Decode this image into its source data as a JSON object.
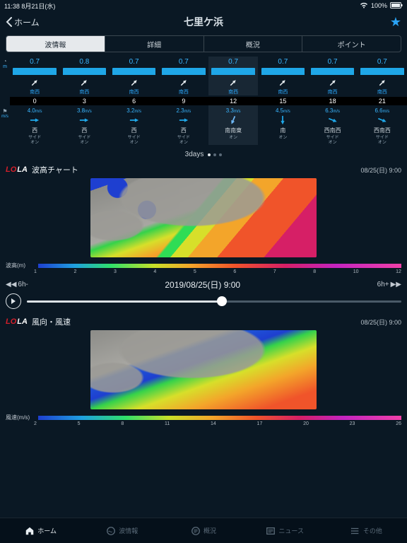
{
  "status": {
    "time": "11:38",
    "date": "8月21日(水)",
    "wifi": "wifi-icon",
    "battery": "100%"
  },
  "nav": {
    "back_label": "ホーム",
    "title": "七里ケ浜"
  },
  "tabs": [
    "波情報",
    "詳細",
    "概況",
    "ポイント"
  ],
  "forecast": {
    "hours": [
      "0",
      "3",
      "6",
      "9",
      "12",
      "15",
      "18",
      "21"
    ],
    "wave_height": [
      "0.7",
      "0.8",
      "0.7",
      "0.7",
      "0.7",
      "0.7",
      "0.7",
      "0.7"
    ],
    "wave_dir_label": [
      "南西",
      "南西",
      "南西",
      "南西",
      "南西",
      "南西",
      "南西",
      "南西"
    ],
    "wind_speed": [
      "4.0",
      "3.8",
      "3.2",
      "2.3",
      "3.3",
      "4.5",
      "6.3",
      "6.6"
    ],
    "wind_unit": "m/s",
    "wind_dir_label": [
      "西",
      "西",
      "西",
      "西",
      "南南東",
      "南",
      "西南西",
      "西南西"
    ],
    "side_label": [
      "サイド\nオン",
      "サイド\nオン",
      "サイド\nオン",
      "サイド\nオン",
      "オン",
      "オン",
      "サイド\nオン",
      "サイド\nオン"
    ],
    "highlight_index": 4,
    "pagination_label": "3days"
  },
  "chart1": {
    "title": "波高チャート",
    "timestamp": "08/25(日) 9:00",
    "scale_label": "波高(m)",
    "ticks": [
      "1",
      "2",
      "3",
      "4",
      "5",
      "6",
      "7",
      "8",
      "10",
      "12"
    ]
  },
  "scrubber": {
    "left": "6h-",
    "right": "6h+",
    "center": "2019/08/25(日) 9:00"
  },
  "chart2": {
    "title": "風向・風速",
    "timestamp": "08/25(日) 9:00",
    "scale_label": "風速(m/s)",
    "ticks": [
      "2",
      "5",
      "8",
      "11",
      "14",
      "17",
      "20",
      "23",
      "26"
    ]
  },
  "bottom_tabs": [
    "ホーム",
    "波情報",
    "概況",
    "ニュース",
    "その他"
  ],
  "chart_data": [
    {
      "type": "table",
      "title": "Hourly wave & wind forecast",
      "categories": [
        "0",
        "3",
        "6",
        "9",
        "12",
        "15",
        "18",
        "21"
      ],
      "series": [
        {
          "name": "wave_height_m",
          "values": [
            0.7,
            0.8,
            0.7,
            0.7,
            0.7,
            0.7,
            0.7,
            0.7
          ]
        },
        {
          "name": "wave_dir",
          "values": [
            "南西",
            "南西",
            "南西",
            "南西",
            "南西",
            "南西",
            "南西",
            "南西"
          ]
        },
        {
          "name": "wind_speed_mps",
          "values": [
            4.0,
            3.8,
            3.2,
            2.3,
            3.3,
            4.5,
            6.3,
            6.6
          ]
        },
        {
          "name": "wind_dir",
          "values": [
            "西",
            "西",
            "西",
            "西",
            "南南東",
            "南",
            "西南西",
            "西南西"
          ]
        }
      ]
    },
    {
      "type": "heatmap",
      "title": "波高チャート 08/25(日) 9:00",
      "xlabel": "",
      "ylabel": "",
      "colorbar_label": "波高(m)",
      "color_ticks": [
        1,
        2,
        3,
        4,
        5,
        6,
        7,
        8,
        10,
        12
      ]
    },
    {
      "type": "heatmap",
      "title": "風向・風速 08/25(日) 9:00",
      "colorbar_label": "風速(m/s)",
      "color_ticks": [
        2,
        5,
        8,
        11,
        14,
        17,
        20,
        23,
        26
      ]
    }
  ]
}
